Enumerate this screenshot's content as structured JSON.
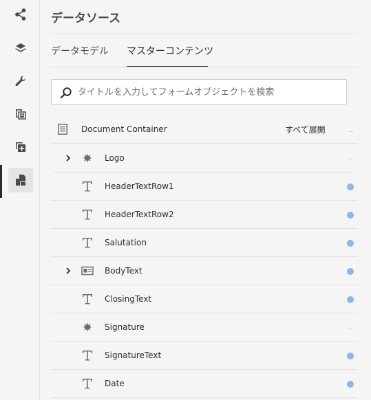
{
  "sidebar": {
    "icons": [
      {
        "name": "share-icon"
      },
      {
        "name": "layers-icon"
      },
      {
        "name": "wrench-icon"
      },
      {
        "name": "document-grid-icon"
      },
      {
        "name": "add-copy-icon"
      },
      {
        "name": "master-content-icon",
        "active": true
      }
    ]
  },
  "panel": {
    "title": "データソース",
    "tabs": [
      {
        "label": "データモデル"
      },
      {
        "label": "マスターコンテンツ",
        "active": true
      }
    ],
    "search": {
      "placeholder": "タイトルを入力してフォームオブジェクトを検索"
    },
    "root": {
      "label": "Document Container",
      "expand_all": "すべて展開"
    },
    "items": [
      {
        "label": "Logo",
        "icon": "image-asset-icon",
        "expandable": true,
        "status": "none"
      },
      {
        "label": "HeaderTextRow1",
        "icon": "text-icon",
        "expandable": false,
        "status": "dot"
      },
      {
        "label": "HeaderTextRow2",
        "icon": "text-icon",
        "expandable": false,
        "status": "dot"
      },
      {
        "label": "Salutation",
        "icon": "text-icon",
        "expandable": false,
        "status": "dot"
      },
      {
        "label": "BodyText",
        "icon": "fragment-icon",
        "expandable": true,
        "status": "dot"
      },
      {
        "label": "ClosingText",
        "icon": "text-icon",
        "expandable": false,
        "status": "dot"
      },
      {
        "label": "Signature",
        "icon": "image-asset-icon",
        "expandable": false,
        "status": "none"
      },
      {
        "label": "SignatureText",
        "icon": "text-icon",
        "expandable": false,
        "status": "dot"
      },
      {
        "label": "Date",
        "icon": "text-icon",
        "expandable": false,
        "status": "dot"
      }
    ]
  },
  "colors": {
    "status_dot": "#8ab6ea",
    "active_rail_bg": "#e4e4e4"
  }
}
